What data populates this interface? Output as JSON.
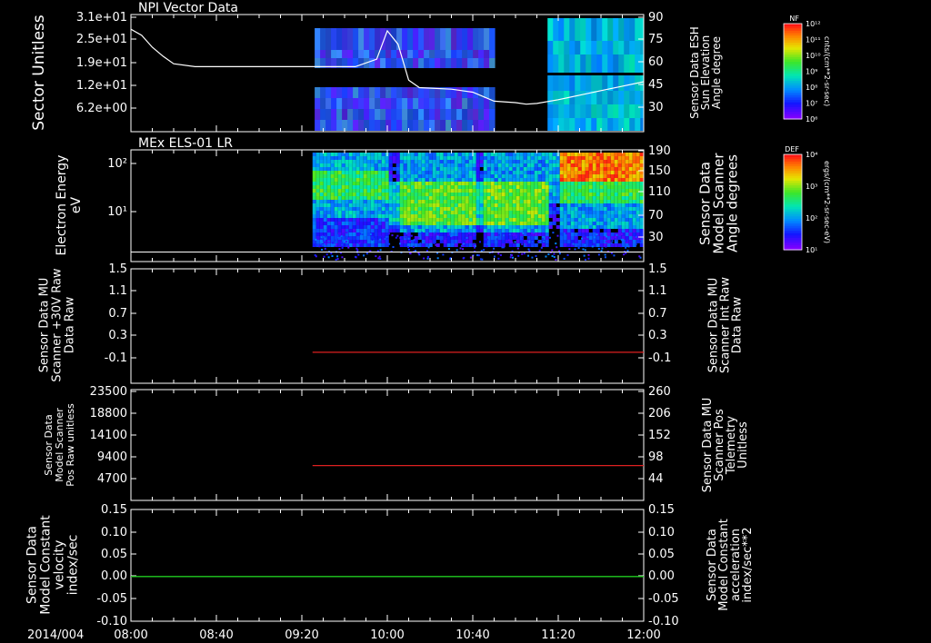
{
  "colors": {
    "background": "#000000",
    "axis": "#ffffff",
    "red": "#dd2020",
    "green": "#20cc20"
  },
  "chart_data": [
    {
      "type": "heatmap",
      "title": "NPI Vector Data",
      "ylabel": "Sector Unitless",
      "y_ticks": [
        "3.1e+01",
        "2.5e+01",
        "1.9e+01",
        "1.2e+01",
        "6.2e+00"
      ],
      "y2label": "Sensor Data ESH Sun Elevation Angle degree",
      "y2_ticks": [
        "90",
        "75",
        "60",
        "45",
        "30"
      ],
      "y2lim": [
        15,
        90
      ],
      "colorbar": {
        "label": "NF",
        "units": "cnts/(cm**2-sr-sec)",
        "ticks": [
          "10¹²",
          "10¹¹",
          "10¹⁰",
          "10⁹",
          "10⁸",
          "10⁷",
          "10⁶"
        ]
      },
      "data_windows": [
        [
          "09:26",
          "10:50"
        ],
        [
          "11:15",
          "12:00"
        ]
      ],
      "line_series": {
        "name": "Sensor Data ESH Sun Elevation Angle",
        "x": [
          "08:00",
          "08:05",
          "08:10",
          "08:15",
          "08:20",
          "08:30",
          "09:00",
          "09:30",
          "09:45",
          "09:55",
          "10:00",
          "10:05",
          "10:10",
          "10:15",
          "10:30",
          "10:40",
          "10:50",
          "11:00",
          "11:05",
          "11:10",
          "11:20",
          "11:30",
          "11:40",
          "11:50",
          "12:00"
        ],
        "y": [
          82,
          78,
          70,
          64,
          59,
          57,
          57,
          57,
          57,
          62,
          81,
          72,
          48,
          43,
          42,
          40,
          34,
          33,
          32,
          32.5,
          35,
          38,
          41,
          44,
          47
        ]
      }
    },
    {
      "type": "heatmap",
      "title": "MEx ELS-01 LR",
      "ylabel": "Electron Energy eV",
      "y_ticks": [
        "10²",
        "10¹"
      ],
      "y2label": "Sensor Data Model Scanner Angle degrees",
      "y2_ticks": [
        "190",
        "150",
        "110",
        "70",
        "30"
      ],
      "y2lim": [
        0,
        190
      ],
      "colorbar": {
        "label": "DEF",
        "units": "ergs/(cm**2-sr-sec-eV)",
        "ticks": [
          "10⁴",
          "10³",
          "10²",
          "10¹"
        ]
      },
      "data_windows": [
        [
          "09:25",
          "12:00"
        ]
      ],
      "line_series": {
        "name": "Sensor Data Model Scanner Angle",
        "x": [
          "08:00",
          "12:00"
        ],
        "y": [
          10,
          10
        ]
      }
    },
    {
      "type": "line",
      "ylabel": "Sensor Data MU Scanner +30V Raw Data Raw",
      "y_ticks": [
        "1.5",
        "1.1",
        "0.7",
        "0.3",
        "-0.1"
      ],
      "ylim": [
        -0.5,
        1.5
      ],
      "y2label": "Sensor Data MU Scanner Int Raw Data Raw",
      "y2_ticks": [
        "1.5",
        "1.1",
        "0.7",
        "0.3",
        "-0.1"
      ],
      "series": [
        {
          "color": "#dd2020",
          "x": [
            "09:25",
            "12:00"
          ],
          "y": [
            0.0,
            0.0
          ]
        }
      ]
    },
    {
      "type": "line",
      "ylabel": "Sensor Data Model Scanner Pos Raw unitless",
      "y_ticks": [
        "23500",
        "18800",
        "14100",
        "9400",
        "4700"
      ],
      "ylim": [
        0,
        23500
      ],
      "y2label": "Sensor Data MU Scanner Pos Telemetry Unitless",
      "y2_ticks": [
        "260",
        "206",
        "152",
        "98",
        "44"
      ],
      "series": [
        {
          "color": "#dd2020",
          "x": [
            "09:25",
            "12:00"
          ],
          "y": [
            7520,
            7520
          ]
        }
      ]
    },
    {
      "type": "line",
      "ylabel": "Sensor Data Model Constant velocity index/sec",
      "y_ticks": [
        "0.15",
        "0.10",
        "0.05",
        "0.00",
        "-0.05",
        "-0.10"
      ],
      "ylim": [
        -0.1,
        0.15
      ],
      "y2label": "Sensor Data Model Constant acceleration index/sec**2",
      "y2_ticks": [
        "0.15",
        "0.10",
        "0.05",
        "0.00",
        "-0.05",
        "-0.10"
      ],
      "series": [
        {
          "color": "#20cc20",
          "x": [
            "08:00",
            "12:00"
          ],
          "y": [
            0.0,
            0.0
          ]
        }
      ]
    }
  ],
  "x_axis": {
    "date_label": "2014/004",
    "ticks": [
      "08:00",
      "08:40",
      "09:20",
      "10:00",
      "10:40",
      "11:20",
      "12:00"
    ]
  }
}
